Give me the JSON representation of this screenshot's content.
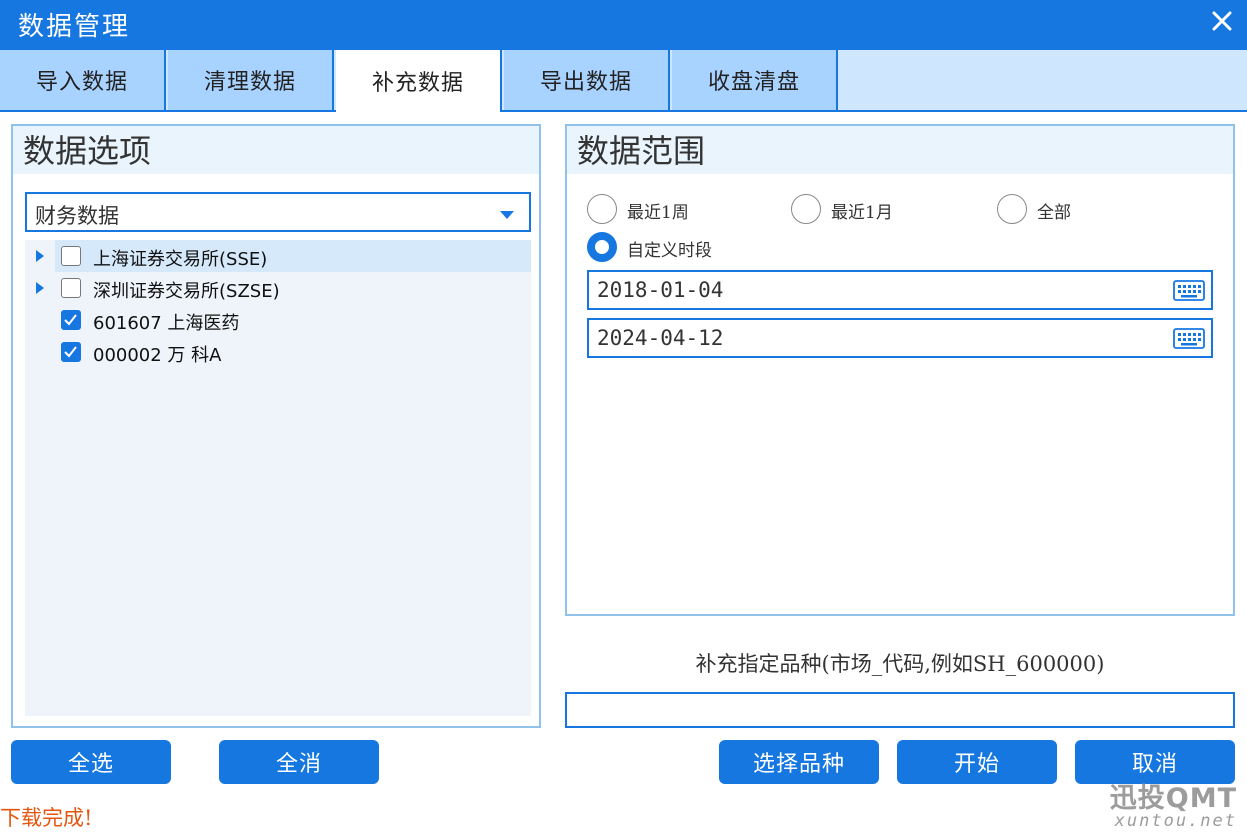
{
  "window": {
    "title": "数据管理"
  },
  "tabs": [
    {
      "label": "导入数据",
      "active": false
    },
    {
      "label": "清理数据",
      "active": false
    },
    {
      "label": "补充数据",
      "active": true
    },
    {
      "label": "导出数据",
      "active": false
    },
    {
      "label": "收盘清盘",
      "active": false
    }
  ],
  "options_panel": {
    "title": "数据选项",
    "dropdown_value": "财务数据",
    "tree": [
      {
        "label": "上海证券交易所(SSE)",
        "checked": false,
        "expandable": true,
        "selected": true
      },
      {
        "label": "深圳证券交易所(SZSE)",
        "checked": false,
        "expandable": true,
        "selected": false
      },
      {
        "label": "601607 上海医药",
        "checked": true,
        "expandable": false,
        "selected": false
      },
      {
        "label": "000002 万 科A",
        "checked": true,
        "expandable": false,
        "selected": false
      }
    ]
  },
  "range_panel": {
    "title": "数据范围",
    "radios": [
      {
        "label": "最近1周",
        "checked": false
      },
      {
        "label": "最近1月",
        "checked": false
      },
      {
        "label": "全部",
        "checked": false
      },
      {
        "label": "自定义时段",
        "checked": true
      }
    ],
    "start_date": "2018-01-04",
    "end_date": "2024-04-12"
  },
  "symbol_hint": "补充指定品种(市场_代码,例如SH_600000)",
  "symbol_value": "",
  "buttons": {
    "select_all": "全选",
    "clear_all": "全消",
    "choose_symbols": "选择品种",
    "start": "开始",
    "cancel": "取消"
  },
  "status_text": "下载完成!",
  "watermark": {
    "brand": "迅投QMT",
    "site": "xuntou.net"
  },
  "colors": {
    "accent": "#1677e0",
    "tab_inactive": "#a8d2ff",
    "panel_border": "#90c2ec",
    "status": "#e4560f"
  }
}
